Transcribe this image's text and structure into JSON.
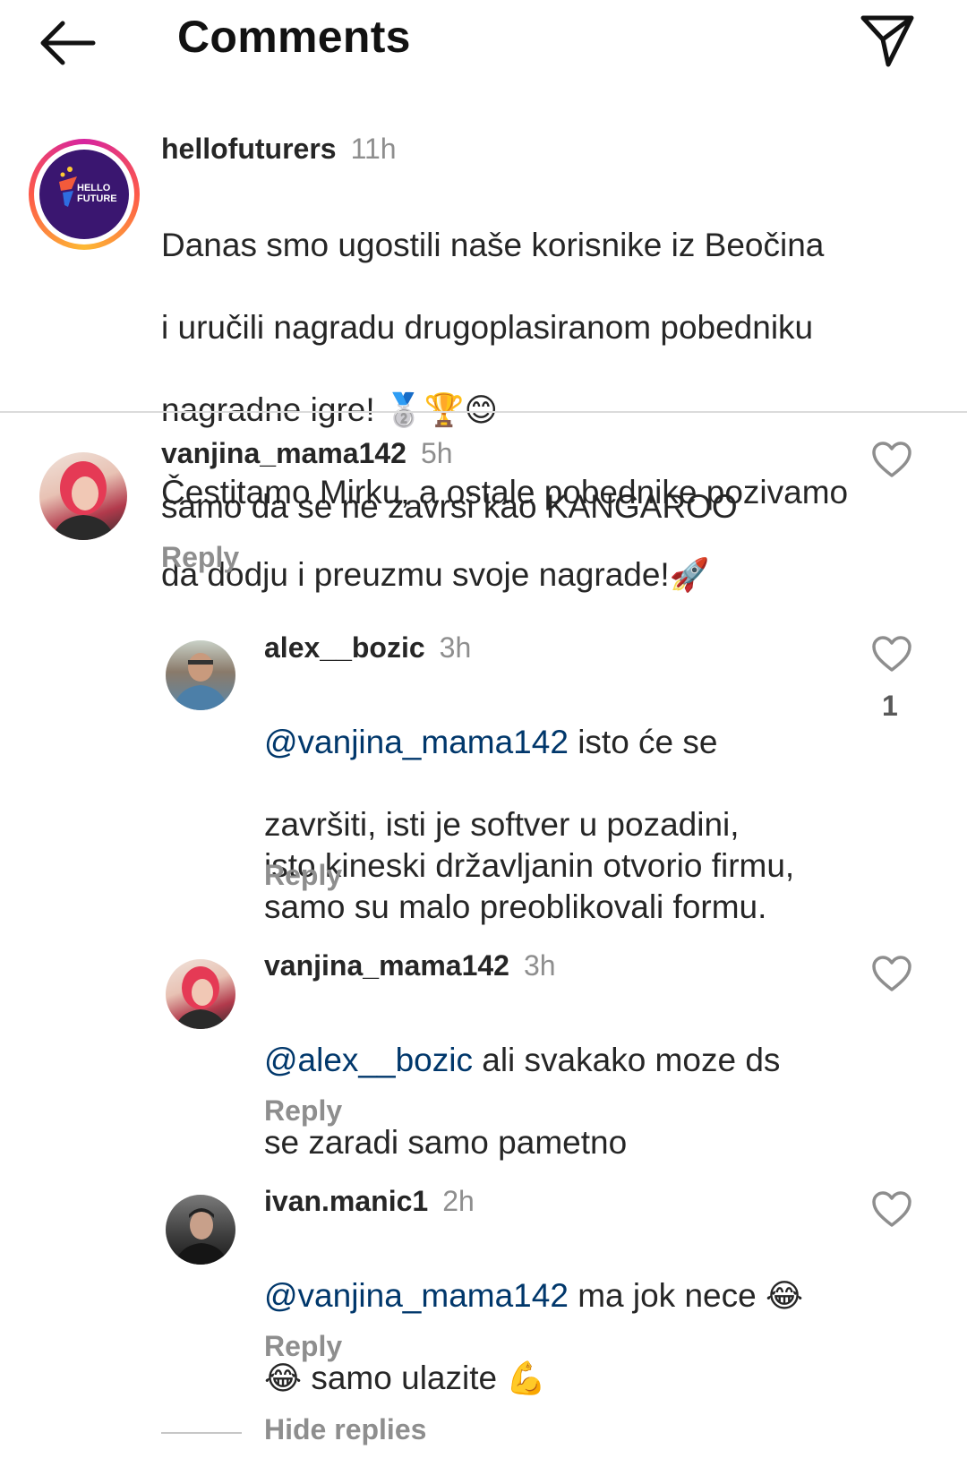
{
  "header": {
    "title": "Comments",
    "back_icon": "arrow-left-icon",
    "share_icon": "paper-plane-icon"
  },
  "caption": {
    "username": "hellofuturers",
    "time": "11h",
    "avatar_text_1": "HELLO",
    "avatar_text_2": "FUTURE",
    "line1": "Danas smo ugostili naše korisnike iz Beočina",
    "line2": "i uručili nagradu drugoplasiranom pobedniku",
    "line3": "nagradne igre!",
    "line3_emojis": "🥈🏆😊",
    "line4": "Čestitamo Mirku, a ostale pobednike pozivamo",
    "line5": "da dodju i preuzmu svoje nagrade!",
    "line5_emoji": "🚀"
  },
  "comments": [
    {
      "username": "vanjina_mama142",
      "time": "5h",
      "text": "samo da se ne zavrsi kao KANGAROO",
      "reply_label": "Reply"
    },
    {
      "username": "alex__bozic",
      "time": "3h",
      "mention": "@vanjina_mama142",
      "text_first": " isto će se",
      "text_rest": "završiti, isti je softver u pozadini,\nisto kineski državljanin otvorio firmu,\nsamo su malo preoblikovali formu.",
      "likes": "1",
      "reply_label": "Reply"
    },
    {
      "username": "vanjina_mama142",
      "time": "3h",
      "mention": "@alex__bozic",
      "text_first": " ali svakako moze ds",
      "text_rest": "se zaradi samo pametno",
      "reply_label": "Reply"
    },
    {
      "username": "ivan.manic1",
      "time": "2h",
      "mention": "@vanjina_mama142",
      "text_first": " ma jok nece",
      "emoji_1": "😂",
      "emoji_2": "😂",
      "text_rest": " samo ulazite",
      "emoji_3": "💪",
      "reply_label": "Reply"
    }
  ],
  "hide_replies_label": "Hide replies",
  "colors": {
    "mention": "#00376b",
    "muted": "#8e8e8e",
    "text": "#262626",
    "divider": "#dbdbdb"
  }
}
